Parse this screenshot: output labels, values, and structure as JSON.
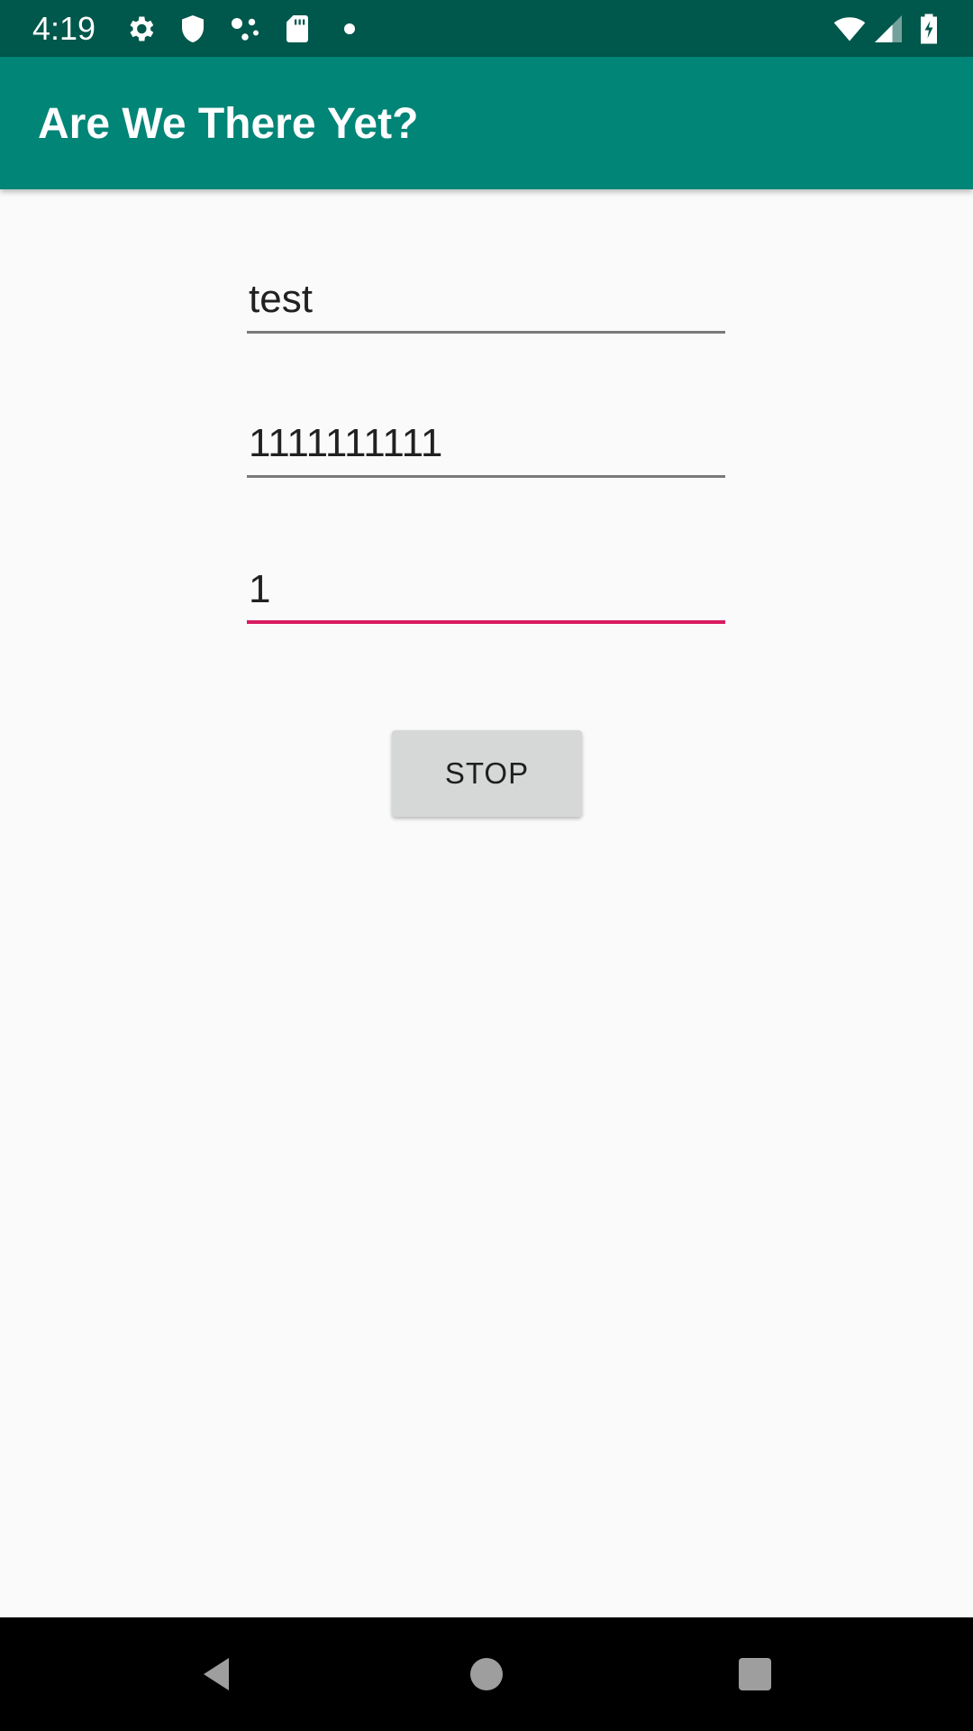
{
  "status_bar": {
    "time": "4:19",
    "icons": [
      "settings-icon",
      "shield-icon",
      "dots-icon",
      "sd-card-icon",
      "notification-dot-icon",
      "wifi-icon",
      "signal-icon",
      "battery-charging-icon"
    ]
  },
  "app_bar": {
    "title": "Are We There Yet?"
  },
  "form": {
    "field1_value": "test",
    "field2_value": "1111111111",
    "field3_value": "1"
  },
  "button": {
    "label": "STOP"
  },
  "nav_bar": {
    "icons": [
      "back-icon",
      "home-icon",
      "recents-icon"
    ]
  },
  "colors": {
    "status_bar": "#00574b",
    "app_bar": "#008577",
    "accent": "#d81b60",
    "background": "#fafafa",
    "button": "#d6d7d7"
  }
}
